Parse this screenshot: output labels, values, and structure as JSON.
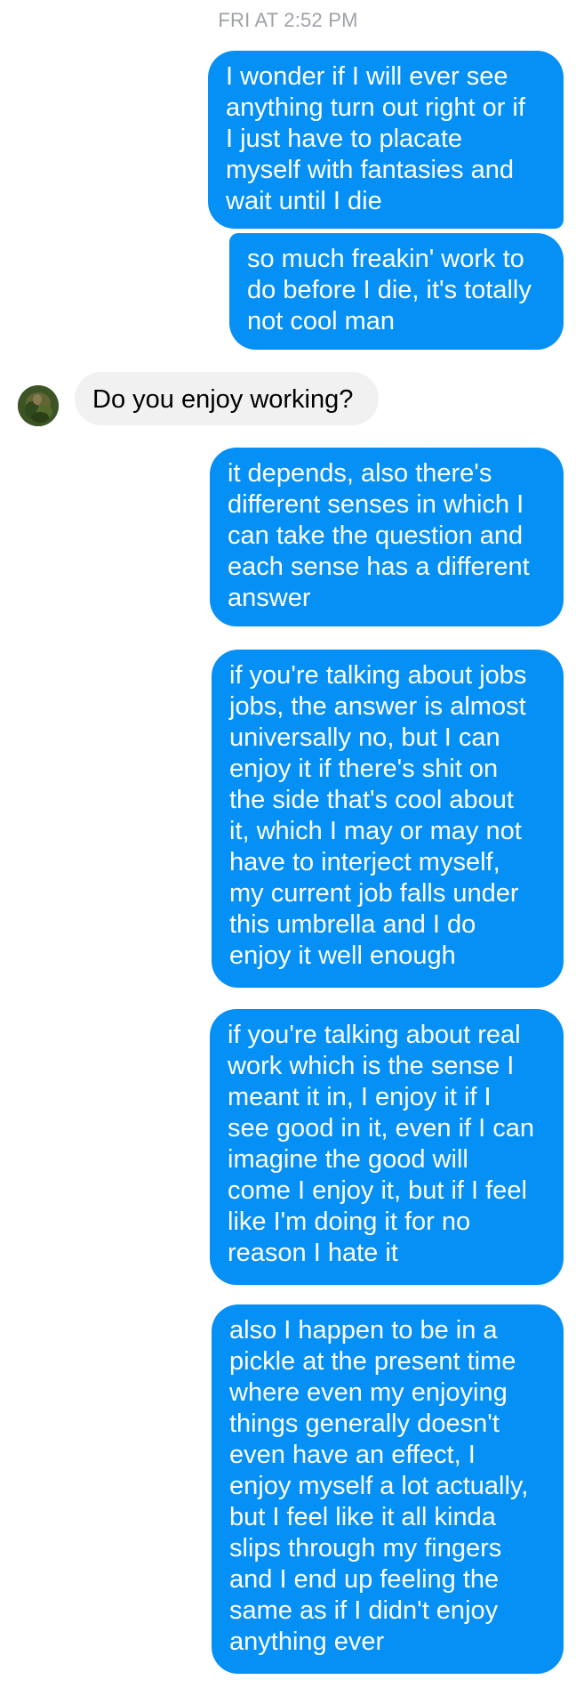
{
  "timestamp": "FRI AT 2:52 PM",
  "messages": [
    {
      "side": "out",
      "lines": [
        "I wonder if I will ever see",
        "anything turn out right or if",
        "I just have to placate",
        "myself with fantasies and",
        "wait until I die"
      ]
    },
    {
      "side": "out",
      "lines": [
        "so much freakin' work to",
        "do before I die, it's totally",
        "not cool man"
      ]
    },
    {
      "side": "in",
      "lines": [
        "Do you enjoy working?"
      ]
    },
    {
      "side": "out",
      "lines": [
        "it depends, also there's",
        "different senses in which I",
        "can take the question and",
        "each sense has a different",
        "answer"
      ]
    },
    {
      "side": "out",
      "lines": [
        "if you're talking about jobs",
        "jobs, the answer is almost",
        "universally no, but I can",
        "enjoy it if there's shit on",
        "the side that's cool about",
        "it, which I may or may not",
        "have to interject myself,",
        "my current job falls under",
        "this umbrella and I do",
        "enjoy it well enough"
      ]
    },
    {
      "side": "out",
      "lines": [
        "if you're talking about real",
        "work which is the sense I",
        "meant it in, I enjoy it if I",
        "see good in it, even if I can",
        "imagine the good will",
        "come I enjoy it, but if I feel",
        "like I'm doing it for no",
        "reason I hate it"
      ]
    },
    {
      "side": "out",
      "lines": [
        "also I happen to be in a",
        "pickle at the present time",
        "where even my enjoying",
        "things generally doesn't",
        "even have an effect, I",
        "enjoy myself a lot actually,",
        "but I feel like it all kinda",
        "slips through my fingers",
        "and I end up feeling the",
        "same as if I didn't enjoy",
        "anything ever"
      ]
    }
  ],
  "colors": {
    "outgoing_bubble": "#0590f5",
    "incoming_bubble": "#f1f1f1",
    "timestamp_text": "#9ea2a8"
  }
}
